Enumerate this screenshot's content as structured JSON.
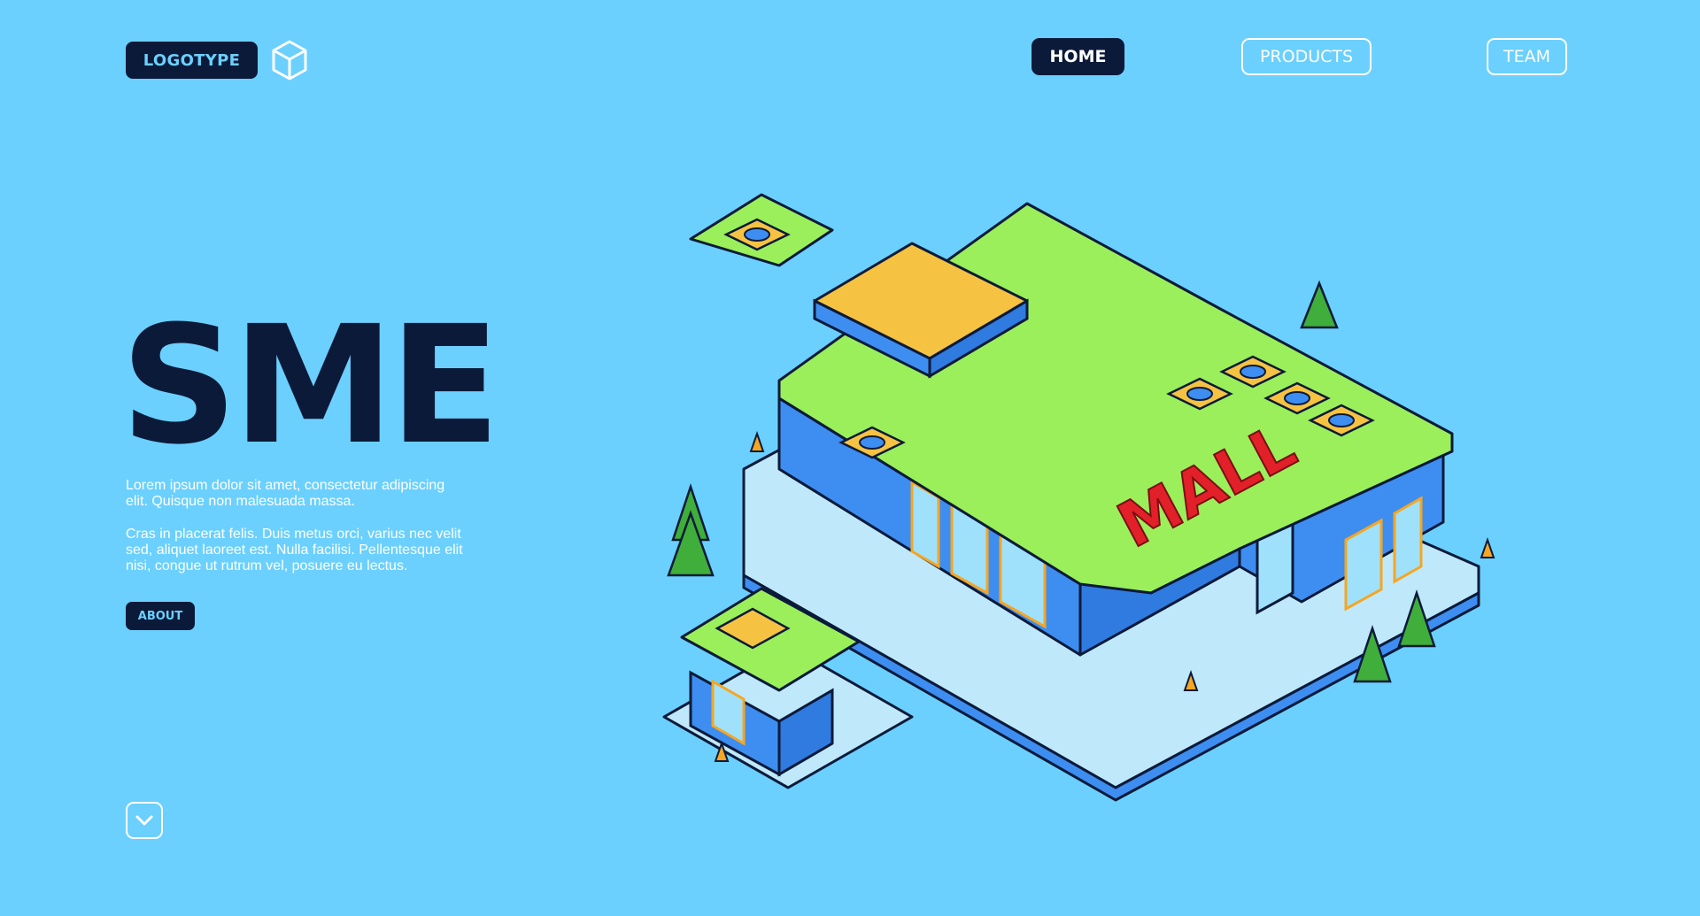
{
  "header": {
    "logo_text": "LOGOTYPE",
    "logo_icon": "cube-icon",
    "nav": {
      "home": "HOME",
      "products": "PRODUCTS",
      "team": "TEAM"
    }
  },
  "hero": {
    "title": "SME",
    "paragraph_1": "Lorem ipsum dolor sit amet, consectetur adipiscing elit. Quisque non malesuada massa.",
    "paragraph_2": "Cras in placerat felis. Duis metus orci, varius nec velit sed, aliquet laoreet est. Nulla facilisi. Pellentesque elit nisi, congue ut rutrum vel, posuere eu lectus.",
    "about_button": "ABOUT",
    "scroll_icon": "chevron-down-icon"
  },
  "illustration": {
    "sign_text": "MALL"
  },
  "colors": {
    "background": "#6bd0fd",
    "dark": "#0c1a3a",
    "roof": "#9bef5a",
    "accent": "#f5c242",
    "building": "#3d8ef0",
    "sign": "#e2202a"
  }
}
